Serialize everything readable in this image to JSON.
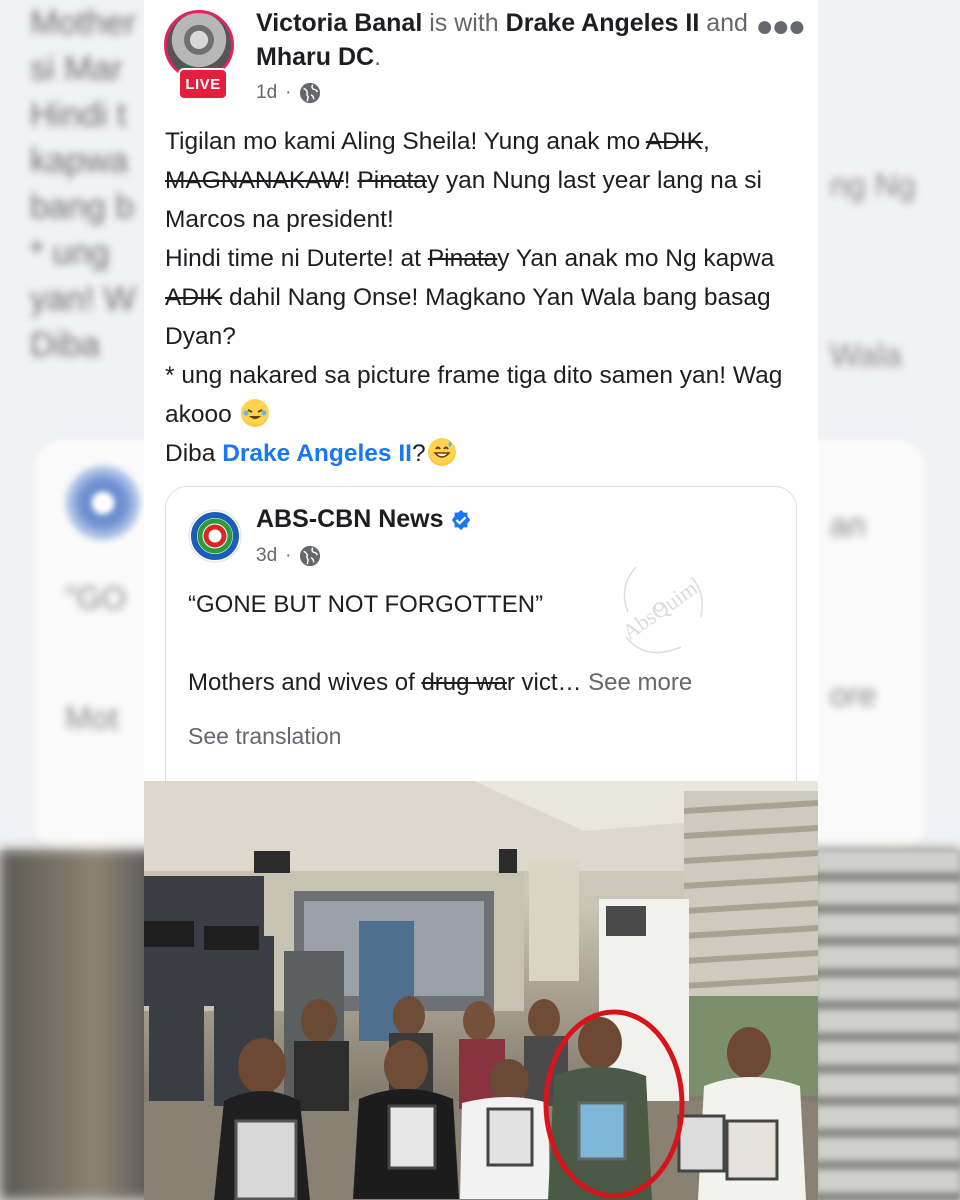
{
  "background": {
    "ghost_text": "Mother\nsi Mar\nHindi t\nkapwa\nbang b\n* ung\nyan! W\nDiba",
    "ghost_right": "ng Ng\nWala\nan\nore",
    "ghost_card_headline": "\"GO",
    "ghost_card_desc": "Mot"
  },
  "post": {
    "author": "Victoria Banal",
    "with_text": "is with",
    "tagged_1": "Drake Angeles II",
    "and_text": "and",
    "tagged_2": "Mharu DC",
    "period": ".",
    "live_label": "LIVE",
    "time": "1d",
    "more_icon": "more-dots-icon",
    "audience_icon": "globe-icon",
    "body": {
      "l1a": "Tigilan mo kami Aling Sheila!  Yung anak mo ",
      "l1_strike": "ADIK",
      "l1b": ", ",
      "l2_strike_a": "MAGNANAKAW",
      "l2a": "! ",
      "l2_strike_b": "Pinata",
      "l2b": "y yan Nung last year lang na si Marcos na president!",
      "l4a": "Hindi time ni Duterte! at ",
      "l4_strike": "Pinata",
      "l4b": "y Yan anak mo Ng kapwa ",
      "l5_strike": "ADIK",
      "l5b": " dahil Nang Onse! Magkano Yan Wala bang basag Dyan?",
      "l7": "* ung nakared sa picture frame tiga dito samen yan! Wag akooo",
      "l9a": "Diba ",
      "l9_mention": "Drake Angeles II",
      "l9b": "?"
    },
    "emoji_laugh": "rolling-laughing-emoji-icon",
    "emoji_sweat": "grinning-sweat-emoji-icon"
  },
  "shared": {
    "page_name": "ABS-CBN News",
    "verified_icon": "verified-badge-icon",
    "time": "3d",
    "headline": "“GONE BUT NOT FORGOTTEN”",
    "desc_a": "Mothers and wives of ",
    "desc_strike": "drug wa",
    "desc_b": "r vict… ",
    "see_more": "See more",
    "see_translation": "See translation",
    "watermark": "AbsQuim",
    "watermark_icon": "watermark-logo-icon"
  },
  "colors": {
    "mention": "#1877f2",
    "live": "#e41e3f",
    "circle": "#d7141a",
    "verified": "#1877f2"
  }
}
